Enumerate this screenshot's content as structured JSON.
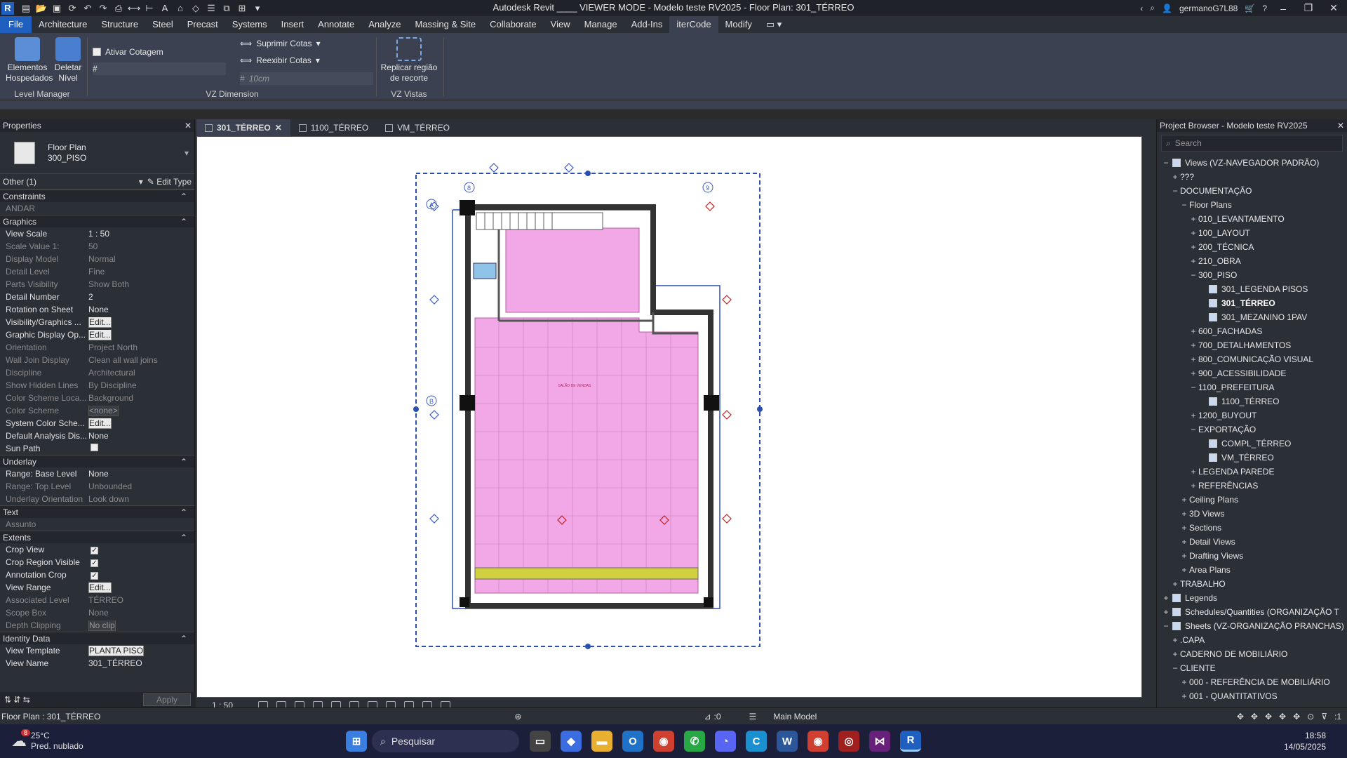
{
  "window": {
    "title": "Autodesk Revit ____ VIEWER MODE - Modelo teste RV2025 - Floor Plan: 301_TÉRREO",
    "user": "germanoG7L88"
  },
  "ribbon_tabs": [
    "File",
    "Architecture",
    "Structure",
    "Steel",
    "Precast",
    "Systems",
    "Insert",
    "Annotate",
    "Analyze",
    "Massing & Site",
    "Collaborate",
    "View",
    "Manage",
    "Add-Ins",
    "iterCode",
    "Modify"
  ],
  "ribbon": {
    "level_manager": {
      "btn1": "Elementos\nHospedados",
      "btn1_a": "Elementos",
      "btn1_b": "Hospedados",
      "btn2_a": "Deletar",
      "btn2_b": "Nível",
      "label": "Level Manager"
    },
    "vz_dimension": {
      "ativar": "Ativar Cotagem",
      "suprimir": "Suprimir Cotas",
      "reexibir": "Reexibir Cotas",
      "offset_placeholder": "10cm",
      "label": "VZ Dimension"
    },
    "vz_vistas": {
      "btn_a": "Replicar região",
      "btn_b": "de recorte",
      "label": "VZ Vistas"
    }
  },
  "properties": {
    "title": "Properties",
    "type_a": "Floor Plan",
    "type_b": "300_PISO",
    "filter": "Other (1)",
    "edit_type": "Edit Type",
    "apply": "Apply",
    "sections": {
      "constraints": "Constraints",
      "graphics": "Graphics",
      "underlay": "Underlay",
      "text": "Text",
      "extents": "Extents",
      "identity": "Identity Data"
    },
    "constraints_rows": [
      {
        "n": "ANDAR",
        "v": ""
      }
    ],
    "graphics_rows": [
      {
        "n": "View Scale",
        "v": "1 : 50"
      },
      {
        "n": "Scale Value    1:",
        "v": "50"
      },
      {
        "n": "Display Model",
        "v": "Normal"
      },
      {
        "n": "Detail Level",
        "v": "Fine"
      },
      {
        "n": "Parts Visibility",
        "v": "Show Both"
      },
      {
        "n": "Detail Number",
        "v": "2"
      },
      {
        "n": "Rotation on Sheet",
        "v": "None"
      },
      {
        "n": "Visibility/Graphics ...",
        "v": "Edit..."
      },
      {
        "n": "Graphic Display Op...",
        "v": "Edit..."
      },
      {
        "n": "Orientation",
        "v": "Project North"
      },
      {
        "n": "Wall Join Display",
        "v": "Clean all wall joins"
      },
      {
        "n": "Discipline",
        "v": "Architectural"
      },
      {
        "n": "Show Hidden Lines",
        "v": "By Discipline"
      },
      {
        "n": "Color Scheme Loca...",
        "v": "Background"
      },
      {
        "n": "Color Scheme",
        "v": "<none>"
      },
      {
        "n": "System Color Sche...",
        "v": "Edit..."
      },
      {
        "n": "Default Analysis Dis...",
        "v": "None"
      },
      {
        "n": "Sun Path",
        "v": ""
      }
    ],
    "underlay_rows": [
      {
        "n": "Range: Base Level",
        "v": "None"
      },
      {
        "n": "Range: Top Level",
        "v": "Unbounded"
      },
      {
        "n": "Underlay Orientation",
        "v": "Look down"
      }
    ],
    "text_rows": [
      {
        "n": "Assunto",
        "v": ""
      }
    ],
    "extents_rows": [
      {
        "n": "Crop View",
        "v": ""
      },
      {
        "n": "Crop Region Visible",
        "v": ""
      },
      {
        "n": "Annotation Crop",
        "v": ""
      },
      {
        "n": "View Range",
        "v": "Edit..."
      },
      {
        "n": "Associated Level",
        "v": "TÉRREO"
      },
      {
        "n": "Scope Box",
        "v": "None"
      },
      {
        "n": "Depth Clipping",
        "v": "No clip"
      }
    ],
    "identity_rows": [
      {
        "n": "View Template",
        "v": "PLANTA PISO"
      },
      {
        "n": "View Name",
        "v": "301_TÉRREO"
      }
    ]
  },
  "view_tabs": [
    "301_TÉRREO",
    "1100_TÉRREO",
    "VM_TÉRREO"
  ],
  "view_bar": {
    "scale": "1 : 50"
  },
  "plan": {
    "room_label": "SALÃO DE VENDAS",
    "grid_a": "A",
    "grid_b": "B",
    "grid_8": "8",
    "grid_9": "9"
  },
  "browser": {
    "title": "Project Browser - Modelo teste RV2025",
    "search_placeholder": "Search",
    "tree": [
      {
        "t": "Views (VZ-NAVEGADOR PADRÃO)",
        "lvl": 0,
        "tog": "−",
        "ico": true
      },
      {
        "t": "???",
        "lvl": 1,
        "tog": "+"
      },
      {
        "t": "DOCUMENTAÇÃO",
        "lvl": 1,
        "tog": "−"
      },
      {
        "t": "Floor Plans",
        "lvl": 2,
        "tog": "−"
      },
      {
        "t": "010_LEVANTAMENTO",
        "lvl": 3,
        "tog": "+"
      },
      {
        "t": "100_LAYOUT",
        "lvl": 3,
        "tog": "+"
      },
      {
        "t": "200_TÉCNICA",
        "lvl": 3,
        "tog": "+"
      },
      {
        "t": "210_OBRA",
        "lvl": 3,
        "tog": "+"
      },
      {
        "t": "300_PISO",
        "lvl": 3,
        "tog": "−"
      },
      {
        "t": "301_LEGENDA PISOS",
        "lvl": 4,
        "tog": "",
        "ico": true
      },
      {
        "t": "301_TÉRREO",
        "lvl": 4,
        "tog": "",
        "ico": true,
        "bold": true
      },
      {
        "t": "301_MEZANINO 1PAV",
        "lvl": 4,
        "tog": "",
        "ico": true
      },
      {
        "t": "600_FACHADAS",
        "lvl": 3,
        "tog": "+"
      },
      {
        "t": "700_DETALHAMENTOS",
        "lvl": 3,
        "tog": "+"
      },
      {
        "t": "800_COMUNICAÇÃO VISUAL",
        "lvl": 3,
        "tog": "+"
      },
      {
        "t": "900_ACESSIBILIDADE",
        "lvl": 3,
        "tog": "+"
      },
      {
        "t": "1100_PREFEITURA",
        "lvl": 3,
        "tog": "−"
      },
      {
        "t": "1100_TÉRREO",
        "lvl": 4,
        "tog": "",
        "ico": true
      },
      {
        "t": "1200_BUYOUT",
        "lvl": 3,
        "tog": "+"
      },
      {
        "t": "EXPORTAÇÃO",
        "lvl": 3,
        "tog": "−"
      },
      {
        "t": "COMPL_TÉRREO",
        "lvl": 4,
        "tog": "",
        "ico": true
      },
      {
        "t": "VM_TÉRREO",
        "lvl": 4,
        "tog": "",
        "ico": true
      },
      {
        "t": "LEGENDA PAREDE",
        "lvl": 3,
        "tog": "+"
      },
      {
        "t": "REFERÊNCIAS",
        "lvl": 3,
        "tog": "+"
      },
      {
        "t": "Ceiling Plans",
        "lvl": 2,
        "tog": "+"
      },
      {
        "t": "3D Views",
        "lvl": 2,
        "tog": "+"
      },
      {
        "t": "Sections",
        "lvl": 2,
        "tog": "+"
      },
      {
        "t": "Detail Views",
        "lvl": 2,
        "tog": "+"
      },
      {
        "t": "Drafting Views",
        "lvl": 2,
        "tog": "+"
      },
      {
        "t": "Area Plans",
        "lvl": 2,
        "tog": "+"
      },
      {
        "t": "TRABALHO",
        "lvl": 1,
        "tog": "+"
      },
      {
        "t": "Legends",
        "lvl": 0,
        "tog": "+",
        "ico": true
      },
      {
        "t": "Schedules/Quantities (ORGANIZAÇÃO T",
        "lvl": 0,
        "tog": "+",
        "ico": true
      },
      {
        "t": "Sheets (VZ-ORGANIZAÇÃO PRANCHAS)",
        "lvl": 0,
        "tog": "−",
        "ico": true
      },
      {
        "t": ".CAPA",
        "lvl": 1,
        "tog": "+"
      },
      {
        "t": "CADERNO DE MOBILIÁRIO",
        "lvl": 1,
        "tog": "+"
      },
      {
        "t": "CLIENTE",
        "lvl": 1,
        "tog": "−"
      },
      {
        "t": "000 - REFERÊNCIA DE MOBILIÁRIO",
        "lvl": 2,
        "tog": "+"
      },
      {
        "t": "001 - QUANTITATIVOS",
        "lvl": 2,
        "tog": "+"
      }
    ]
  },
  "status": {
    "left": "Floor Plan : 301_TÉRREO",
    "zero": ":0",
    "model": "Main Model",
    "filter_count": ":1"
  },
  "taskbar": {
    "temp": "25°C",
    "weather": "Pred. nublado",
    "search": "Pesquisar",
    "time": "18:58",
    "date": "14/05/2025",
    "badge": "8"
  }
}
